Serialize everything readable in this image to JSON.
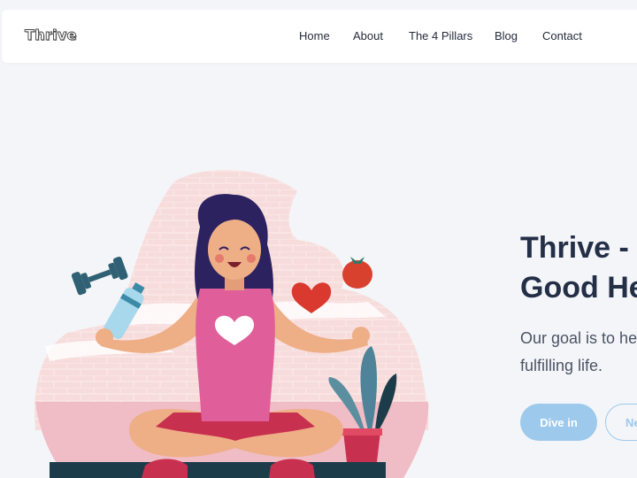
{
  "header": {
    "logo": "Thrive",
    "nav": [
      {
        "label": "Home"
      },
      {
        "label": "About"
      },
      {
        "label": "The 4 Pillars"
      },
      {
        "label": "Blog"
      },
      {
        "label": "Contact"
      }
    ]
  },
  "hero": {
    "title_line1": "Thrive -",
    "title_line2": "Good He",
    "subtitle_line1": "Our goal is to he",
    "subtitle_line2": "fulfilling life.",
    "primary_button": "Dive in",
    "secondary_button": "Ne",
    "illustration": "woman-meditating-wellness-illustration"
  },
  "colors": {
    "background": "#f4f5f8",
    "accent": "#9cc9ec",
    "heading": "#232f47",
    "shirt": "#e05f9a",
    "shorts": "#c8304f",
    "hair": "#2d2260",
    "apple": "#d9412f"
  }
}
